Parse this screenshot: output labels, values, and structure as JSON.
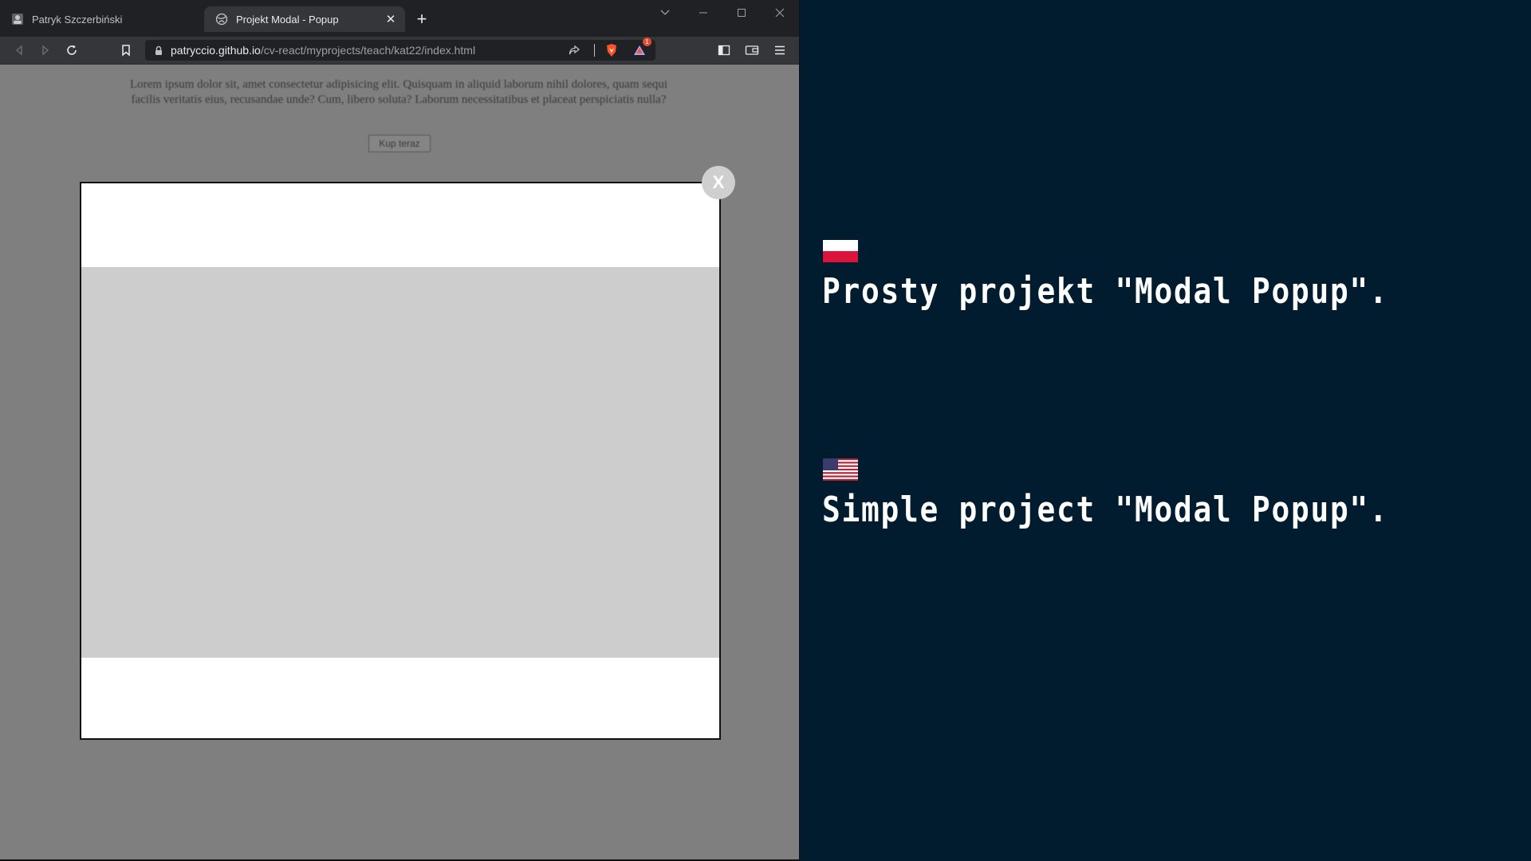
{
  "browser": {
    "tabs": [
      {
        "label": "Patryk Szczerbiński",
        "active": false,
        "icon": "avatar-icon"
      },
      {
        "label": "Projekt Modal - Popup",
        "active": true,
        "icon": "globe-icon"
      }
    ],
    "address": {
      "host": "patryccio.github.io",
      "path": "/cv-react/myprojects/teach/kat22/index.html"
    },
    "notification_count": "1"
  },
  "page": {
    "lorem_text": "Lorem ipsum dolor sit, amet consectetur adipisicing elit. Quisquam in aliquid laborum nihil dolores, quam sequi facilis veritatis eius, recusandae unde? Cum, libero soluta? Laborum necessitatibus et placeat perspiciatis nulla?",
    "buy_button_label": "Kup teraz",
    "modal_close_label": "X"
  },
  "panel": {
    "pl_text": "Prosty projekt \"Modal Popup\".",
    "en_text": "Simple project \"Modal Popup\"."
  },
  "colors": {
    "panel_bg": "#001c2e",
    "overlay": "#7f7f7f",
    "modal_middle": "#cdcdcd",
    "brave_accent": "#fb542b"
  }
}
